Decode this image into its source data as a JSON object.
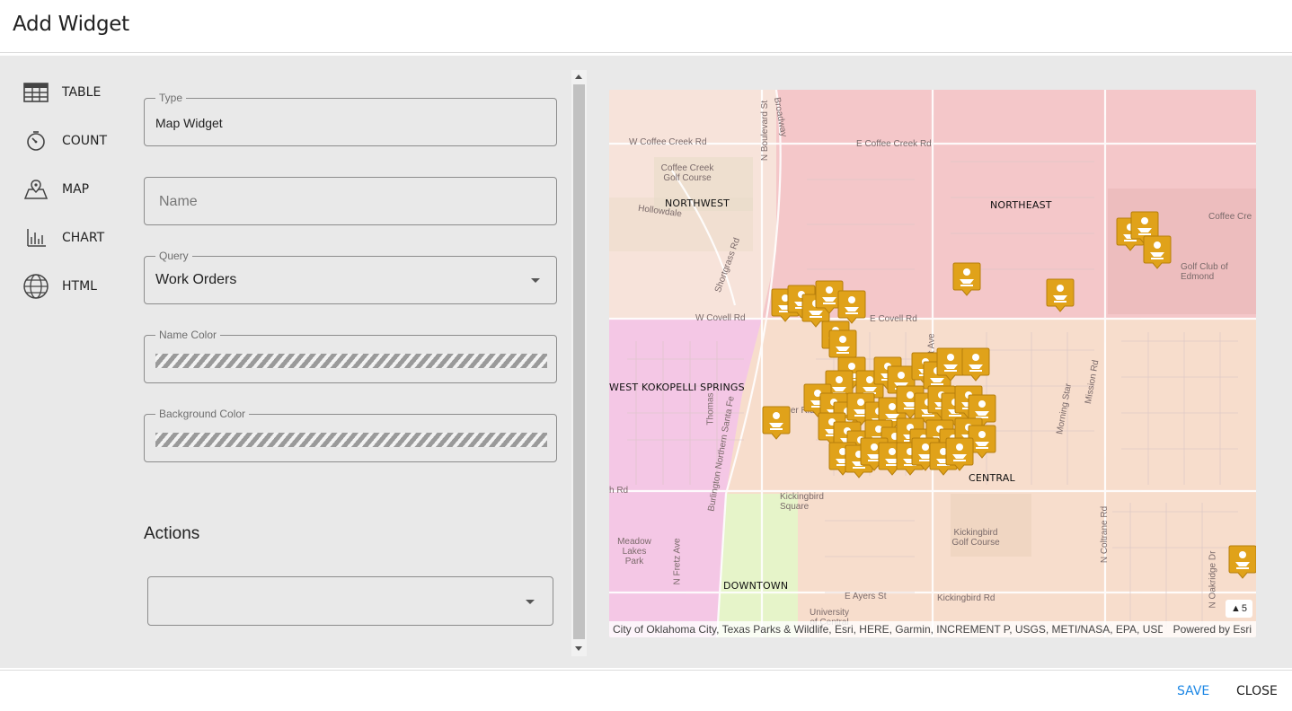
{
  "dialog": {
    "title": "Add Widget"
  },
  "sidebar": {
    "items": [
      {
        "label": "TABLE",
        "icon": "table-icon"
      },
      {
        "label": "COUNT",
        "icon": "timer-icon"
      },
      {
        "label": "MAP",
        "icon": "map-icon"
      },
      {
        "label": "CHART",
        "icon": "chart-icon"
      },
      {
        "label": "HTML",
        "icon": "globe-icon"
      }
    ]
  },
  "form": {
    "type": {
      "label": "Type",
      "value": "Map Widget"
    },
    "name": {
      "placeholder": "Name",
      "value": ""
    },
    "query": {
      "label": "Query",
      "value": "Work Orders"
    },
    "name_color": {
      "label": "Name Color"
    },
    "background_color": {
      "label": "Background Color"
    },
    "actions": {
      "title": "Actions",
      "value": ""
    }
  },
  "map": {
    "regions": [
      "NORTHWEST",
      "NORTHEAST",
      "WEST KOKOPELLI SPRINGS",
      "DOWNTOWN",
      "CENTRAL"
    ],
    "streets": [
      "W Coffee Creek Rd",
      "E Coffee Creek Rd",
      "Coffee Creek Golf Course",
      "Hollowdale",
      "N Boulevard St",
      "Broadway",
      "Shortgrass Rd",
      "W Covell Rd",
      "E Covell Rd",
      "Timber Ridge Rd",
      "Thomas",
      "Burlington Northern Santa Fe",
      "Kickingbird Square",
      "Kickingbird Golf Course",
      "Kickingbird Rd",
      "Meadow Lakes Park",
      "N Fretz Ave",
      "E Ayers St",
      "University of Central",
      "N Coltrane Rd",
      "Morning Star",
      "Mission Rd",
      "Golf Club of Edmond",
      "Coffee Cre",
      "N Oakridge Dr",
      "Bryant Ave",
      "h Rd"
    ],
    "attribution": "City of Oklahoma City, Texas Parks & Wildlife, Esri, HERE, Garmin, INCREMENT P, USGS, METI/NASA, EPA, USD...",
    "powered_by": "Powered by Esri",
    "cluster_count": "5",
    "marker_icon": "work-order-pin-icon",
    "colors": {
      "pin": "#e0a21a",
      "northeast": "#f5c9c9",
      "west": "#f2c6e6",
      "downtown": "#e4f5c9"
    }
  },
  "footer": {
    "save_label": "SAVE",
    "close_label": "CLOSE"
  }
}
